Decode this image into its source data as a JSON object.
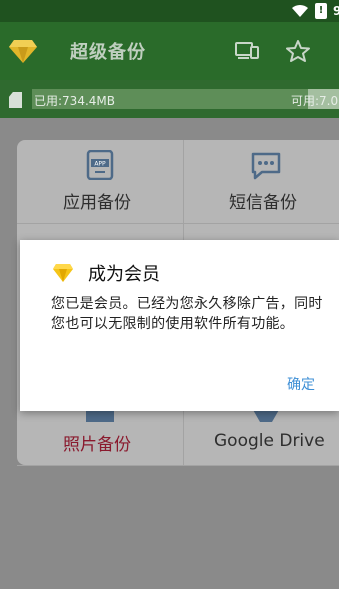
{
  "app": {
    "title": "超级备份",
    "storage": {
      "used_label": "已用:734.4MB",
      "available_label": "可用:7.0",
      "used_fraction": 0.9
    }
  },
  "icons": {
    "logo": "diamond-icon",
    "device": "devices-icon",
    "favorite": "star-icon",
    "sd": "sd-card-icon"
  },
  "grid": {
    "items": [
      {
        "label": "应用备份",
        "icon": "app-icon"
      },
      {
        "label": "短信备份",
        "icon": "sms-icon"
      },
      {
        "label": "照片备份",
        "icon": "photo-icon"
      },
      {
        "label": "Google Drive",
        "icon": "drive-icon"
      }
    ]
  },
  "dialog": {
    "title": "成为会员",
    "message": "您已是会员。已经为您永久移除广告，同时您也可以无限制的使用软件所有功能。",
    "ok_label": "确定"
  },
  "colors": {
    "statusbar": "#1f521f",
    "appbar": "#2a6b2a",
    "accent_link": "#3e8fd6",
    "diamond": "#f5c518"
  }
}
